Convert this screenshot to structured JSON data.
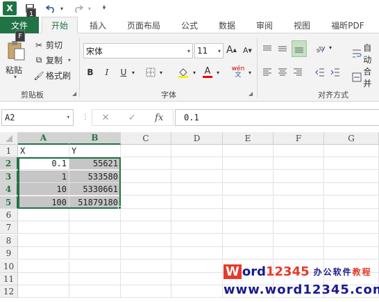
{
  "title_bar": {
    "app_logo": "X",
    "key_tip_save": "1",
    "undo_icon": "undo-icon",
    "redo_icon": "redo-icon"
  },
  "ribbon_tabs": {
    "file": "文件",
    "file_key_tip": "F",
    "items": [
      "开始",
      "插入",
      "页面布局",
      "公式",
      "数据",
      "审阅",
      "视图",
      "福昕PDF"
    ],
    "active": "开始"
  },
  "clipboard": {
    "paste": "粘贴",
    "cut": "剪切",
    "copy": "复制",
    "format_painter": "格式刷",
    "group_label": "剪贴板"
  },
  "font": {
    "name": "宋体",
    "size": "11",
    "bold": "B",
    "italic": "I",
    "underline": "U",
    "phonetic": "wén",
    "group_label": "字体"
  },
  "alignment": {
    "wrap_text": "自动",
    "merge": "合并",
    "group_label": "对齐方式"
  },
  "formula_bar": {
    "name_box": "A2",
    "fx_label": "fx",
    "formula": "0.1"
  },
  "sheet": {
    "columns": [
      "A",
      "B",
      "C",
      "D",
      "E",
      "F",
      "G"
    ],
    "rows": [
      "1",
      "2",
      "3",
      "4",
      "5",
      "6",
      "7",
      "8",
      "9",
      "10",
      "11",
      "12"
    ],
    "cells": {
      "A1": "X",
      "B1": "Y",
      "A2": "0.1",
      "B2": "55621",
      "A3": "1",
      "B3": "533580",
      "A4": "10",
      "B4": "5330661",
      "A5": "100",
      "B5": "51879180"
    },
    "active_cell": "A2",
    "selection": "A2:B5"
  },
  "watermark": {
    "line1_w": "W",
    "line1_ord": "ord",
    "line1_num": "12345",
    "line1_tail": "办公软件",
    "line1_tail2": "教程",
    "line2": "www.word12345.com"
  },
  "colors": {
    "excel_green": "#217346",
    "selection_gray": "#c6c6c6",
    "watermark_red": "#e63a2a",
    "watermark_blue": "#1a1a8c"
  }
}
